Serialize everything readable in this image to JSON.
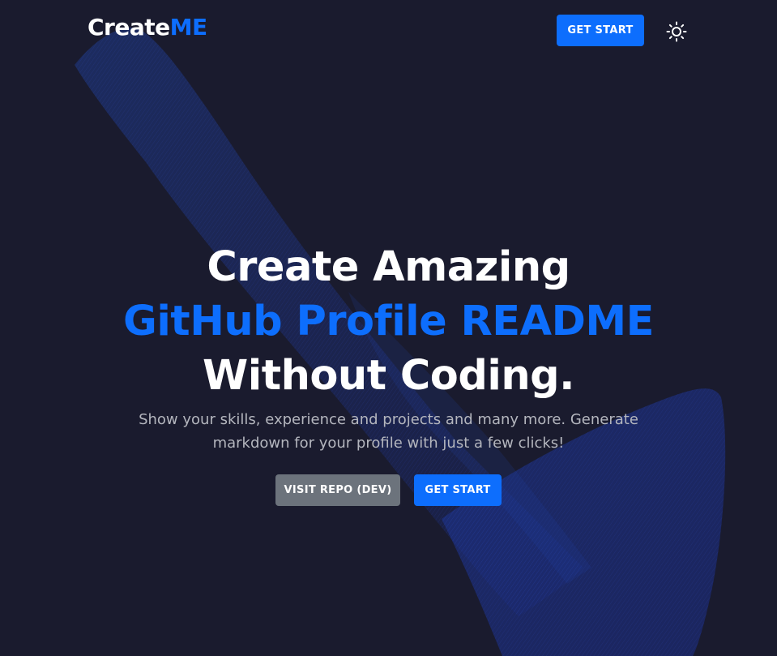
{
  "brand": {
    "logo_prefix": "Create",
    "logo_suffix": "ME"
  },
  "navbar": {
    "cta_label": "GET START",
    "theme_toggle_icon": "sun-icon"
  },
  "hero": {
    "line1": "Create Amazing",
    "line2": "GitHub Profile README",
    "line3": "Without Coding.",
    "subtitle": "Show your skills, experience and projects and many more. Generate markdown for your profile with just a few clicks!",
    "secondary_button": "VISIT REPO (DEV)",
    "primary_button": "GET START"
  },
  "colors": {
    "background": "#1a1b2e",
    "accent": "#0d6efd",
    "secondary_button": "#6c737c",
    "subtitle_text": "#b4b6be"
  }
}
